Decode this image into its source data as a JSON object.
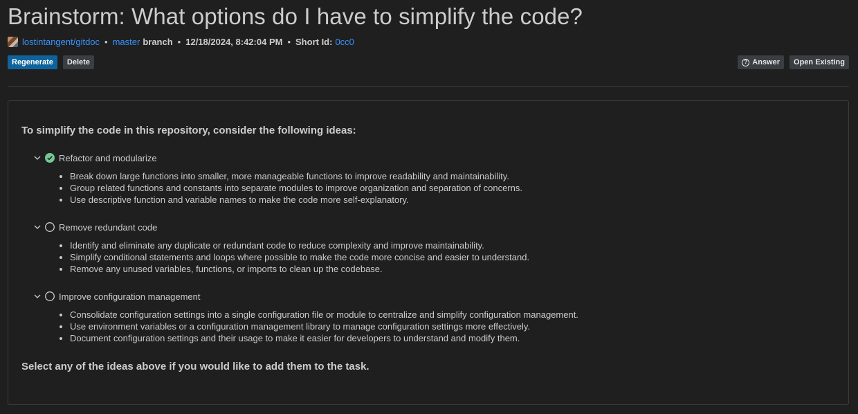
{
  "title": "Brainstorm: What options do I have to simplify the code?",
  "meta": {
    "repo": "lostintangent/gitdoc",
    "branch_name": "master",
    "branch_word": "branch",
    "timestamp": "12/18/2024, 8:42:04 PM",
    "short_id_label": "Short Id:",
    "short_id": "0cc0"
  },
  "toolbar": {
    "regenerate_label": "Regenerate",
    "delete_label": "Delete",
    "answer_label": "Answer",
    "open_existing_label": "Open Existing"
  },
  "content": {
    "intro": "To simplify the code in this repository, consider the following ideas:",
    "ideas": [
      {
        "title": "Refactor and modularize",
        "selected": true,
        "bullets": [
          "Break down large functions into smaller, more manageable functions to improve readability and maintainability.",
          "Group related functions and constants into separate modules to improve organization and separation of concerns.",
          "Use descriptive function and variable names to make the code more self-explanatory."
        ]
      },
      {
        "title": "Remove redundant code",
        "selected": false,
        "bullets": [
          "Identify and eliminate any duplicate or redundant code to reduce complexity and improve maintainability.",
          "Simplify conditional statements and loops where possible to make the code more concise and easier to understand.",
          "Remove any unused variables, functions, or imports to clean up the codebase."
        ]
      },
      {
        "title": "Improve configuration management",
        "selected": false,
        "bullets": [
          "Consolidate configuration settings into a single configuration file or module to centralize and simplify configuration management.",
          "Use environment variables or a configuration management library to manage configuration settings more effectively.",
          "Document configuration settings and their usage to make it easier for developers to understand and modify them."
        ]
      }
    ],
    "outro": "Select any of the ideas above if you would like to add them to the task."
  },
  "colors": {
    "background": "#1f1f1f",
    "text": "#cccccc",
    "link": "#3794ff",
    "primary_button": "#0e639c",
    "secondary_button": "#3a3d41",
    "check_selected": "#73c991",
    "border": "#3c3c3c"
  },
  "icons": {
    "expand": "chevron-down-icon",
    "selected": "check-circle-icon",
    "unselected": "circle-outline-icon",
    "help": "question-circle-icon"
  }
}
